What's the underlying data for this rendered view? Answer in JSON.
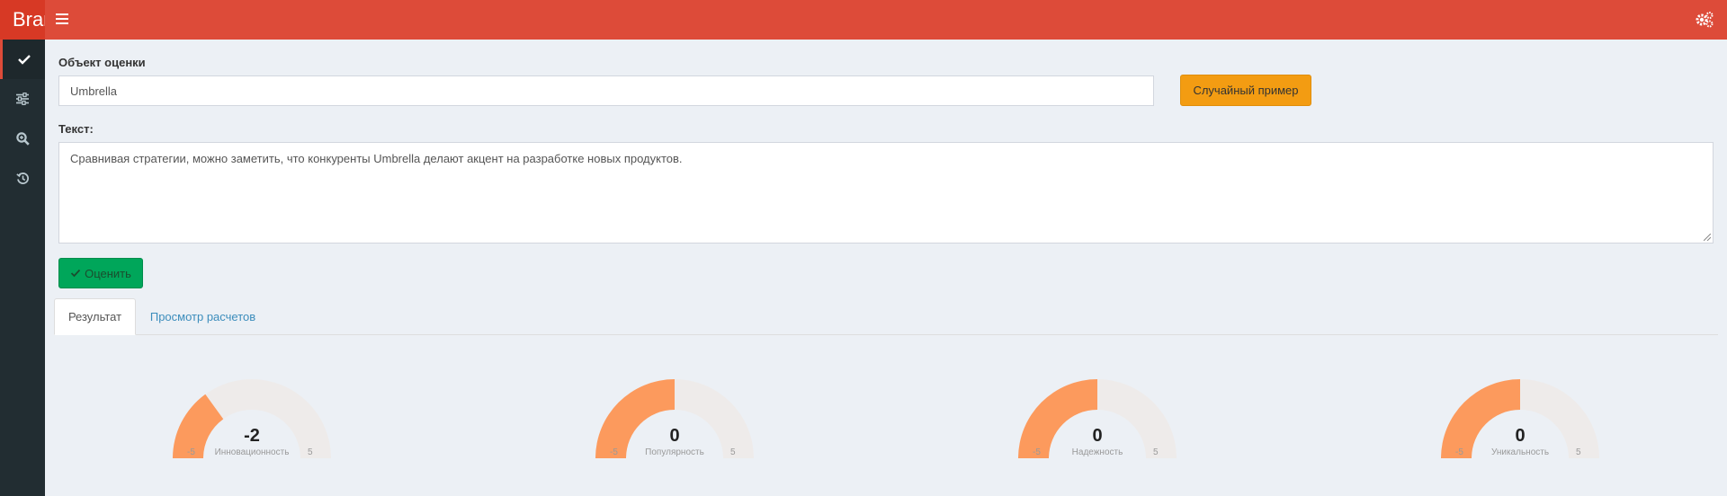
{
  "header": {
    "brand": "Brand",
    "menu_icon": "hamburger-icon",
    "settings_icon": "gears-icon",
    "bar_color": "#dd4b39"
  },
  "sidebar": {
    "items": [
      {
        "icon": "check-icon",
        "active": true
      },
      {
        "icon": "sliders-icon",
        "active": false
      },
      {
        "icon": "search-plus-icon",
        "active": false
      },
      {
        "icon": "history-icon",
        "active": false
      }
    ]
  },
  "form": {
    "object_label": "Объект оценки",
    "object_value": "Umbrella",
    "random_button": "Случайный пример",
    "text_label": "Текст:",
    "text_value": "Сравнивая стратегии, можно заметить, что конкуренты Umbrella делают акцент на разработке новых продуктов.",
    "evaluate_button": "Оценить"
  },
  "tabs": [
    {
      "label": "Результат",
      "active": true
    },
    {
      "label": "Просмотр расчетов",
      "active": false
    }
  ],
  "gauges": [
    {
      "title": "Инновационность",
      "value": "-2",
      "numeric": -2,
      "min": "-5",
      "max": "5"
    },
    {
      "title": "Популярность",
      "value": "0",
      "numeric": 0,
      "min": "-5",
      "max": "5"
    },
    {
      "title": "Надежность",
      "value": "0",
      "numeric": 0,
      "min": "-5",
      "max": "5"
    },
    {
      "title": "Уникальность",
      "value": "0",
      "numeric": 0,
      "min": "-5",
      "max": "5"
    }
  ],
  "colors": {
    "gauge_fill": "#fc9a5d",
    "gauge_track": "#eeebea",
    "random_button": "#f39c12",
    "evaluate_button": "#00a65a",
    "sidebar": "#222d32"
  }
}
